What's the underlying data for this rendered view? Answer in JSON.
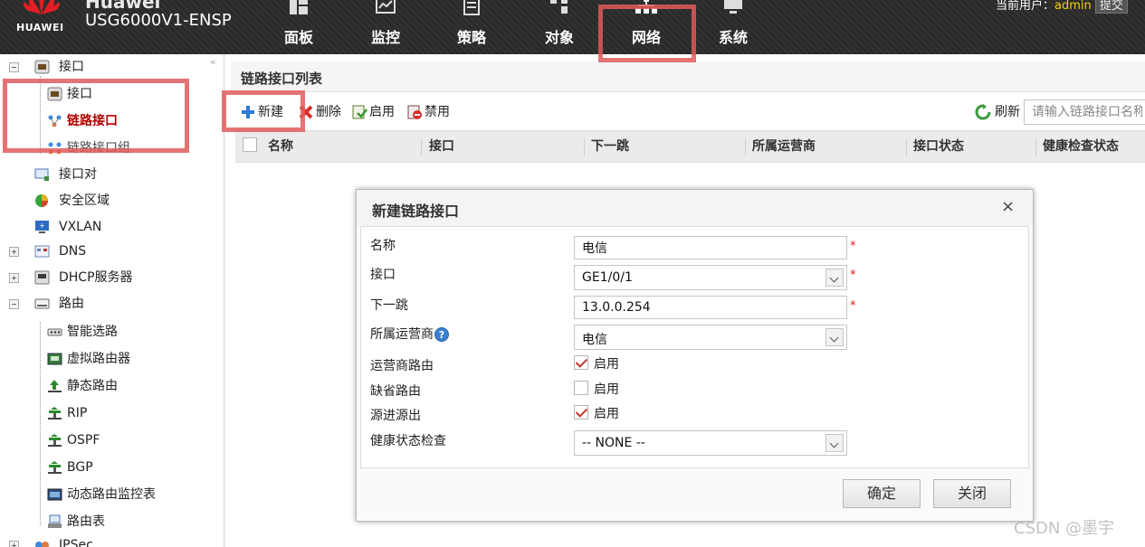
{
  "header": {
    "brand_name": "Huawei",
    "logo_text": "HUAWEI",
    "product_name": "USG6000V1-ENSP",
    "nav": [
      {
        "label": "面板",
        "icon": "dashboard-icon"
      },
      {
        "label": "监控",
        "icon": "monitor-icon"
      },
      {
        "label": "策略",
        "icon": "policy-icon"
      },
      {
        "label": "对象",
        "icon": "object-icon"
      },
      {
        "label": "网络",
        "icon": "network-icon",
        "active": true
      },
      {
        "label": "系统",
        "icon": "system-icon"
      }
    ],
    "user_label": "当前用户：",
    "username": "admin",
    "user_button": "提交"
  },
  "sidebar": {
    "collapse_glyph": "«",
    "items": [
      {
        "label": "接口",
        "icon": "interface-icon"
      },
      {
        "label": "接口",
        "icon": "interface-icon"
      },
      {
        "label": "链路接口",
        "icon": "link-interface-icon",
        "selected": true
      },
      {
        "label": "链路接口组",
        "icon": "link-group-icon"
      },
      {
        "label": "接口对",
        "icon": "interface-pair-icon"
      },
      {
        "label": "安全区域",
        "icon": "security-zone-icon"
      },
      {
        "label": "VXLAN",
        "icon": "vxlan-icon"
      },
      {
        "label": "DNS",
        "icon": "dns-icon"
      },
      {
        "label": "DHCP服务器",
        "icon": "dhcp-icon"
      },
      {
        "label": "路由",
        "icon": "route-icon"
      },
      {
        "label": "智能选路",
        "icon": "smart-route-icon"
      },
      {
        "label": "虚拟路由器",
        "icon": "virtual-router-icon"
      },
      {
        "label": "静态路由",
        "icon": "static-route-icon"
      },
      {
        "label": "RIP",
        "icon": "rip-icon"
      },
      {
        "label": "OSPF",
        "icon": "ospf-icon"
      },
      {
        "label": "BGP",
        "icon": "bgp-icon"
      },
      {
        "label": "动态路由监控表",
        "icon": "route-monitor-icon"
      },
      {
        "label": "路由表",
        "icon": "route-table-icon"
      },
      {
        "label": "IPSec",
        "icon": "ipsec-icon"
      }
    ]
  },
  "main": {
    "panel_title": "链路接口列表",
    "toolbar": {
      "new": "新建",
      "delete": "删除",
      "enable": "启用",
      "disable": "禁用",
      "refresh": "刷新",
      "search_placeholder": "请输入链路接口名称"
    },
    "columns": [
      "名称",
      "接口",
      "下一跳",
      "所属运营商",
      "接口状态",
      "健康检查状态"
    ]
  },
  "dialog": {
    "title": "新建链路接口",
    "close_glyph": "×",
    "fields": {
      "name": {
        "label": "名称",
        "value": "电信"
      },
      "interface": {
        "label": "接口",
        "value": "GE1/0/1"
      },
      "next_hop": {
        "label": "下一跳",
        "value": "13.0.0.254"
      },
      "isp": {
        "label": "所属运营商",
        "value": "电信",
        "help": "?"
      },
      "isp_route": {
        "label": "运营商路由",
        "option": "启用",
        "checked": true
      },
      "default_route": {
        "label": "缺省路由",
        "option": "启用",
        "checked": false
      },
      "source_in_source_out": {
        "label": "源进源出",
        "option": "启用",
        "checked": true
      },
      "health_check": {
        "label": "健康状态检查",
        "value": "-- NONE --"
      }
    },
    "required_mark": "*",
    "ok": "确定",
    "close": "关闭"
  },
  "watermark": "CSDN @墨宇",
  "colors": {
    "header_bg": "#2b2b2b",
    "accent_red": "#e05a5a",
    "selected_text": "#b40000",
    "username": "#f5d100",
    "required": "#e01818"
  }
}
